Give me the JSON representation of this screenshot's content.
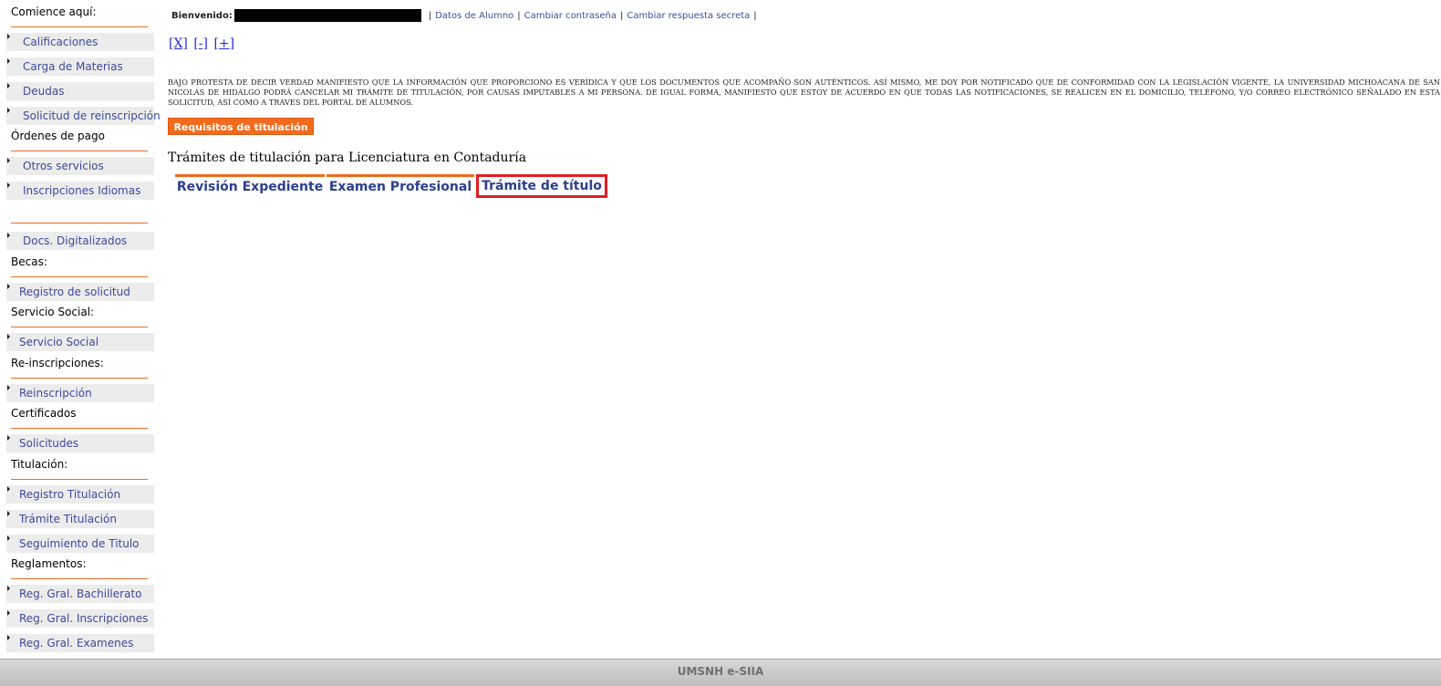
{
  "sidebar": {
    "headers": [
      "Comience aquí:",
      "Órdenes de pago",
      "",
      "Becas:",
      "Servicio Social:",
      "Re-inscripciones:",
      "Certificados",
      "Titulación:",
      "Reglamentos:"
    ],
    "items": [
      "Calificaciones",
      "Carga de Materias",
      "Deudas",
      "Solicitud de reinscripción",
      "Otros servicios",
      "Inscripciones Idiomas",
      "Docs. Digitalizados",
      "Registro de solicitud",
      "Servicio Social",
      "Reinscripción",
      "Solicitudes",
      "Registro Titulación",
      "Trámite Titulación",
      "Seguimiento de Titulo",
      "Reg. Gral. Bachillerato",
      "Reg. Gral. Inscripciones",
      "Reg. Gral. Examenes"
    ]
  },
  "topbar": {
    "welcome": "Bienvenido:",
    "links": [
      "Datos de Alumno",
      "Cambiar contraseña",
      "Cambiar respuesta secreta"
    ]
  },
  "zoom": {
    "close": "[X]",
    "minus": "[-]",
    "plus": "[+]"
  },
  "disclaimer": "BAJO PROTESTA DE DECIR VERDAD MANIFIESTO QUE LA INFORMACIÓN QUE PROPORCIONO ES VERÍDICA Y QUE LOS DOCUMENTOS QUE ACOMPAÑO SON AUTÉNTICOS. ASÍ MISMO, ME DOY POR NOTIFICADO QUE DE CONFORMIDAD CON LA LEGISLACIÓN VIGENTE, LA UNIVERSIDAD MICHOACANA DE SAN NICOLÁS DE HIDALGO PODRÁ CANCELAR MI TRÁMITE DE TITULACIÓN, POR CAUSAS IMPUTABLES A MI PERSONA. DE IGUAL FORMA, MANIFIESTO QUE ESTOY DE ACUERDO EN QUE TODAS LAS NOTIFICACIONES, SE REALICEN EN EL DOMICILIO, TELÉFONO, Y/O CORREO ELECTRÓNICO SEÑALADO EN ESTA SOLICITUD, ASÍ COMO A TRAVES DEL PORTAL DE ALUMNOS.",
  "requirements_button": "Requisitos de titulación",
  "process_title": "Trámites de titulación para Licenciatura en Contaduría",
  "tabs": [
    "Revisión Expediente",
    "Examen Profesional",
    "Trámite de título"
  ],
  "footer": "UMSNH e-SIIA",
  "colors": {
    "accent": "#f26b1d",
    "link": "#3d4c9b",
    "tab_text": "#2c3e8f",
    "highlight": "#e11d24",
    "nav_bg": "#ececec"
  }
}
